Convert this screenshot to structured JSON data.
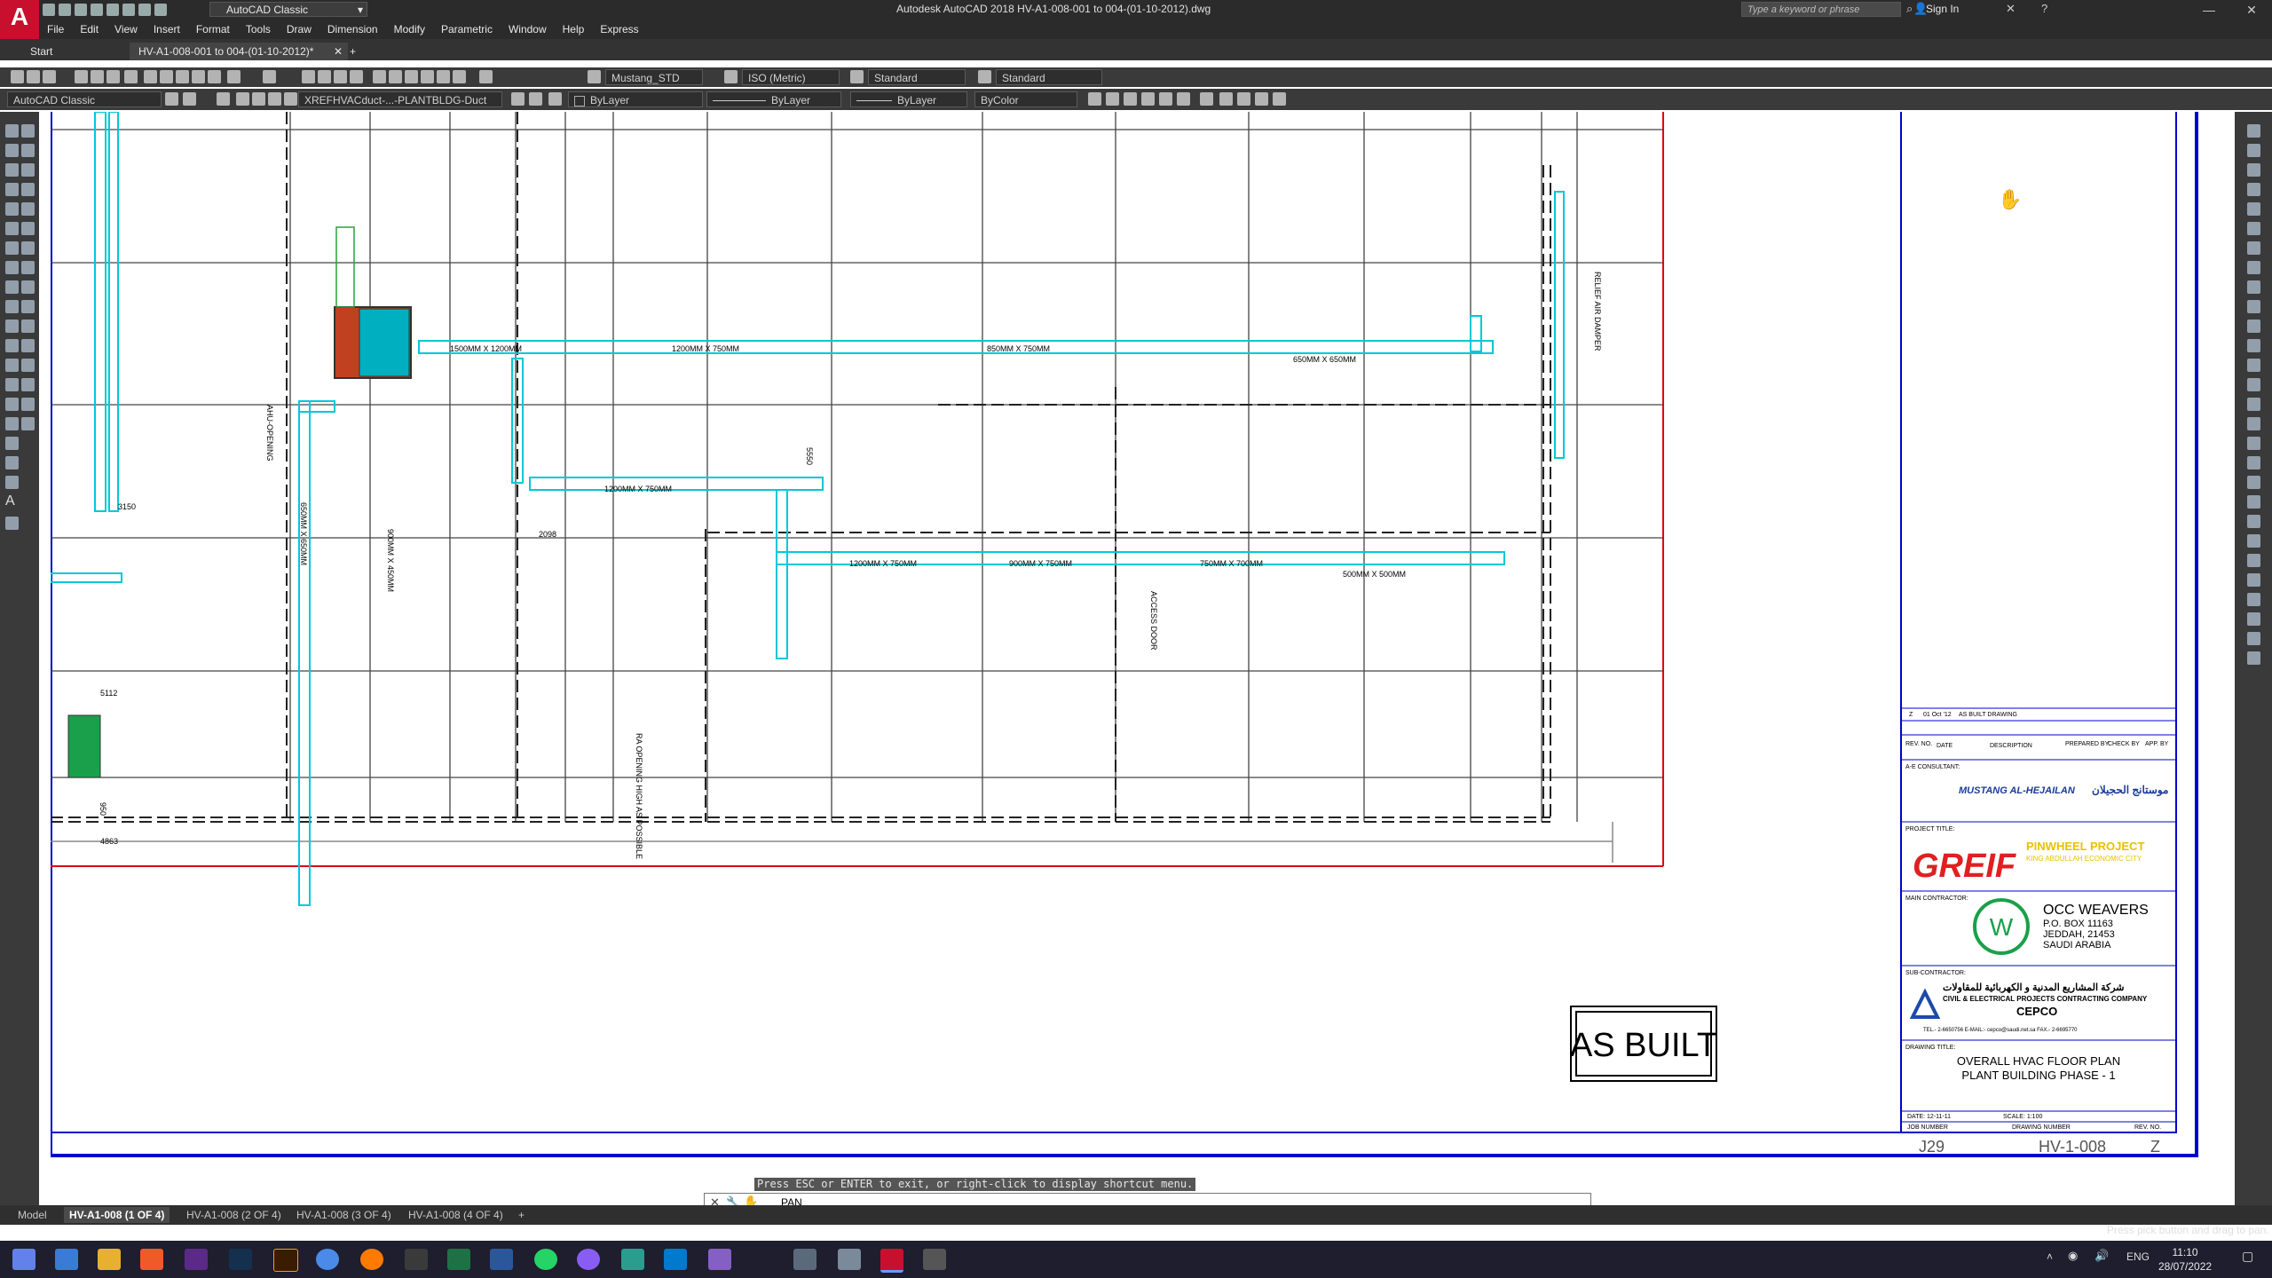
{
  "app": {
    "title": "Autodesk AutoCAD 2018    HV-A1-008-001 to 004-(01-10-2012).dwg",
    "logo": "A",
    "workspace": "AutoCAD Classic",
    "search_placeholder": "Type a keyword or phrase",
    "signin": "Sign In"
  },
  "menu": [
    "File",
    "Edit",
    "View",
    "Insert",
    "Format",
    "Tools",
    "Draw",
    "Dimension",
    "Modify",
    "Parametric",
    "Window",
    "Help",
    "Express"
  ],
  "file_tabs": {
    "start": "Start",
    "active": "HV-A1-008-001 to 004-(01-10-2012)*",
    "add": "+"
  },
  "toolbar1": {
    "text_style": "Mustang_STD",
    "dim_style": "ISO (Metric)",
    "table_style": "Standard",
    "mleader_style": "Standard"
  },
  "toolbar2": {
    "workspace": "AutoCAD Classic",
    "layer": "XREFHVACduct-...-PLANTBLDG-Duct",
    "color": "ByLayer",
    "linetype": "ByLayer",
    "lineweight": "ByLayer",
    "plotstyle": "ByColor"
  },
  "drawing": {
    "stamp": "AS BUILT",
    "duct_labels": {
      "d1": "1500MM X 1200MM",
      "d2": "1200MM X 750MM",
      "d3": "850MM X 750MM",
      "d4": "650MM X 650MM",
      "d5": "1200MM X 750MM",
      "d6": "1200MM X 750MM",
      "d7": "900MM X 750MM",
      "d8": "750MM X 700MM",
      "d9": "500MM X 500MM"
    },
    "dims": {
      "a": "3150",
      "b": "2098",
      "c": "5112",
      "d": "4863",
      "e": "5550",
      "f": "950"
    },
    "notes": {
      "n1": "900MM X 450MM",
      "n2": "ACCESS DOOR",
      "n3": "AHU-OPENING",
      "n4": "RELIEF AIR DAMPER",
      "n5": "650MM X 650MM",
      "n6": "RA OPENING HIGH AS POSSIBLE"
    }
  },
  "titleblock": {
    "rev_row": {
      "rev": "Z",
      "date": "01 Oct '12",
      "desc": "AS BUILT DRAWING"
    },
    "rev_headers": [
      "REV. NO.",
      "DATE",
      "DESCRIPTION",
      "PREPARED BY",
      "CHECK BY",
      "APP. BY"
    ],
    "ae_label": "A-E CONSULTANT:",
    "consultant": "MUSTANG AL-HEJAILAN",
    "consultant_ar": "موستانج الحجيلان",
    "project_label": "PROJECT TITLE:",
    "client": "GREIF",
    "project": "PINWHEEL PROJECT",
    "project_sub": "KING ABDULLAH ECONOMIC CITY",
    "contractor_label": "MAIN CONTRACTOR:",
    "contractor": "OCC WEAVERS",
    "contractor_addr": [
      "P.O. BOX 11163",
      "JEDDAH, 21453",
      "SAUDI ARABIA"
    ],
    "sub_label": "SUB-CONTRACTOR:",
    "sub_ar": "شركة المشاريع المدنية و الكهربائية للمقاولات",
    "sub_en": "CIVIL & ELECTRICAL PROJECTS CONTRACTING COMPANY",
    "sub_short": "CEPCO",
    "sub_contact": "TEL.- 2-6650756     E-MAIL:- cepco@saudi.net.sa     FAX.- 2-6695770",
    "dwg_label": "DRAWING TITLE:",
    "dwg_title": "OVERALL HVAC FLOOR PLAN",
    "dwg_sub": "PLANT BUILDING PHASE - 1",
    "date": "DATE: 12-11-11",
    "scale": "SCALE: 1:100",
    "job_label": "JOB NUMBER",
    "drawing_label": "DRAWING NUMBER",
    "rev_label": "REV. NO.",
    "job": "J29",
    "drawing_no": "HV-1-008",
    "rev": "Z"
  },
  "command": {
    "hint": "Press ESC or ENTER to exit, or right-click to display shortcut menu.",
    "text": "PAN",
    "status": "Press pick button and drag to pan."
  },
  "layout_tabs": [
    "Model",
    "HV-A1-008 (1 OF 4)",
    "HV-A1-008 (2 OF 4)",
    "HV-A1-008 (3 OF 4)",
    "HV-A1-008 (4 OF 4)",
    "+"
  ],
  "taskbar": {
    "lang": "ENG",
    "time": "11:10",
    "date": "28/07/2022"
  },
  "colors": {
    "duct": "#00c8d8",
    "wall": "#000000",
    "arrow": "#e00000",
    "border_blue": "#0000cc",
    "border_red": "#e00000",
    "accent": "#c8102e"
  }
}
